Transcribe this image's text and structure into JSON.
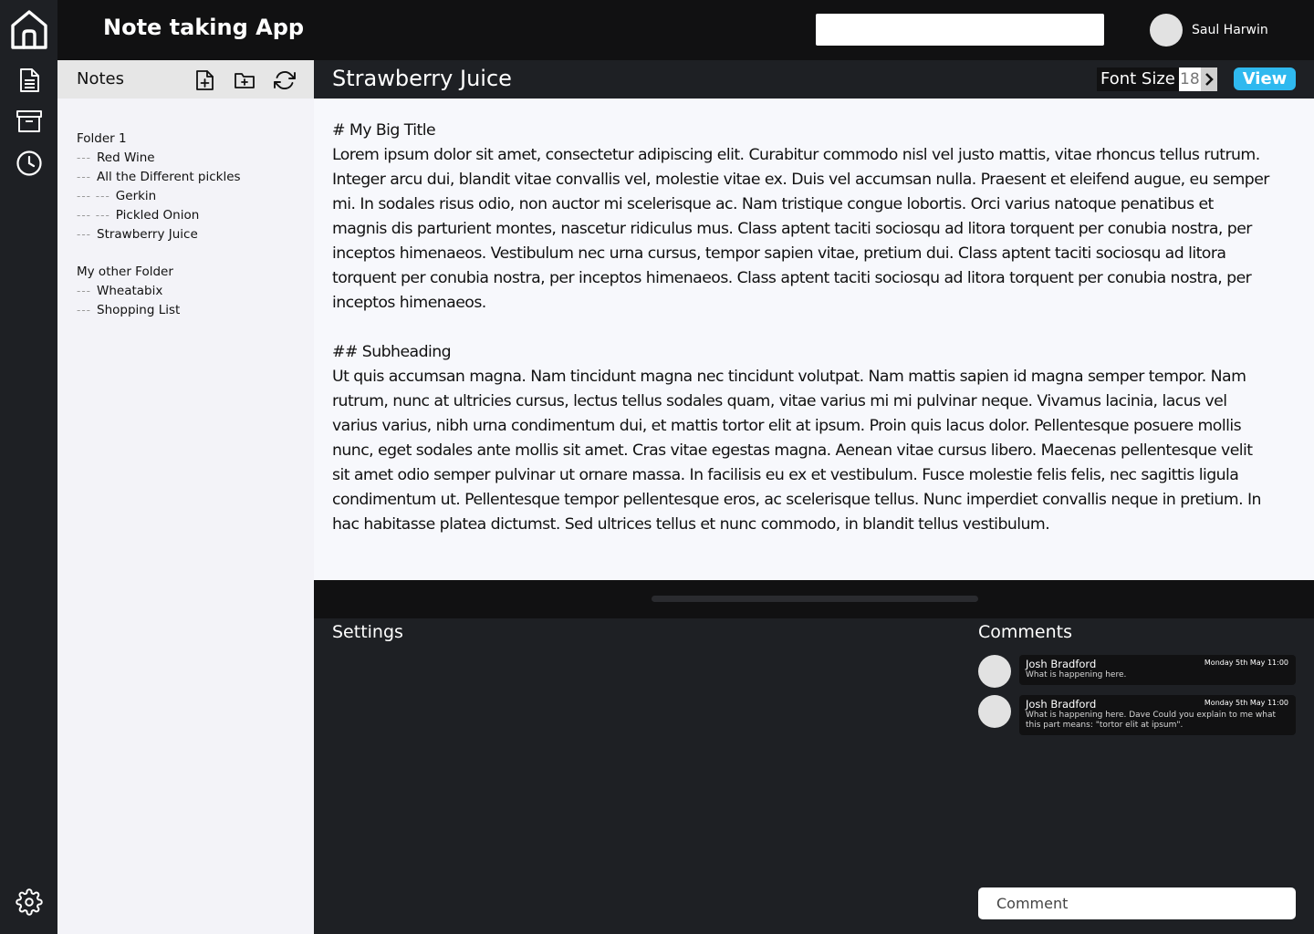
{
  "app": {
    "title": "Note taking App"
  },
  "search": {
    "placeholder": ""
  },
  "user": {
    "name": "Saul Harwin"
  },
  "rail": {
    "icons": [
      "home-icon",
      "document-icon",
      "archive-icon",
      "clock-icon",
      "gear-icon"
    ]
  },
  "notes_panel": {
    "title": "Notes",
    "tools": [
      "new-note-icon",
      "new-folder-icon",
      "refresh-icon"
    ],
    "folders": [
      {
        "name": "Folder 1",
        "items": [
          {
            "label": "Red Wine",
            "dashes": "---"
          },
          {
            "label": "All the Different pickles",
            "dashes": "---"
          },
          {
            "label": "Gerkin",
            "dashes": "--- ---"
          },
          {
            "label": "Pickled Onion",
            "dashes": "--- ---"
          },
          {
            "label": "Strawberry Juice",
            "dashes": "---"
          }
        ]
      },
      {
        "name": "My other Folder",
        "items": [
          {
            "label": "Wheatabix",
            "dashes": "---"
          },
          {
            "label": "Shopping List",
            "dashes": "---"
          }
        ]
      }
    ]
  },
  "editor": {
    "title": "Strawberry Juice",
    "font_size_label": "Font Size",
    "font_size_value": "18",
    "view_label": "View",
    "heading1": "# My Big Title",
    "para1": "Lorem ipsum dolor sit amet, consectetur adipiscing elit. Curabitur commodo nisl vel justo mattis, vitae rhoncus tellus rutrum. Integer arcu dui, blandit vitae convallis vel, molestie vitae ex. Duis vel accumsan nulla. Praesent et eleifend augue, eu semper mi. In sodales risus odio, non auctor mi scelerisque ac. Nam tristique congue lobortis. Orci varius natoque penatibus et magnis dis parturient montes, nascetur ridiculus mus. Class aptent taciti sociosqu ad litora torquent per conubia nostra, per inceptos himenaeos. Vestibulum nec urna cursus, tempor sapien vitae, pretium dui. Class aptent taciti sociosqu ad litora torquent per conubia nostra, per inceptos himenaeos. Class aptent taciti sociosqu ad litora torquent per conubia nostra, per inceptos himenaeos.",
    "heading2": "## Subheading",
    "para2": "Ut quis accumsan magna. Nam tincidunt magna nec tincidunt volutpat. Nam mattis sapien id magna semper tempor. Nam rutrum, nunc at ultricies cursus, lectus tellus sodales quam, vitae varius mi mi pulvinar neque. Vivamus lacinia, lacus vel varius varius, nibh urna condimentum dui, et mattis tortor elit at ipsum. Proin quis lacus dolor. Pellentesque posuere mollis nunc, eget sodales ante mollis sit amet. Cras vitae egestas magna. Aenean vitae cursus libero. Maecenas pellentesque velit sit amet odio semper pulvinar ut ornare massa. In facilisis eu ex et vestibulum. Fusce molestie felis felis, nec sagittis ligula condimentum ut. Pellentesque tempor pellentesque eros, ac scelerisque tellus. Nunc imperdiet convallis neque in pretium. In hac habitasse platea dictumst. Sed ultrices tellus et nunc commodo, in blandit tellus vestibulum."
  },
  "drawer": {
    "settings_title": "Settings",
    "comments_title": "Comments",
    "comments": [
      {
        "author": "Josh Bradford",
        "date": "Monday 5th May 11:00",
        "text": "What is happening here."
      },
      {
        "author": "Josh Bradford",
        "date": "Monday 5th May 11:00",
        "text": "What is happening here. Dave Could you explain to me what this part means: \"tortor elit at ipsum\"."
      }
    ],
    "comment_placeholder": "Comment"
  },
  "colors": {
    "rail_bg": "#1e2024",
    "topbar_bg": "#111112",
    "panel_bg": "#f3f3f8",
    "editor_bg": "#f7f8fc",
    "accent": "#2fb9ef"
  }
}
